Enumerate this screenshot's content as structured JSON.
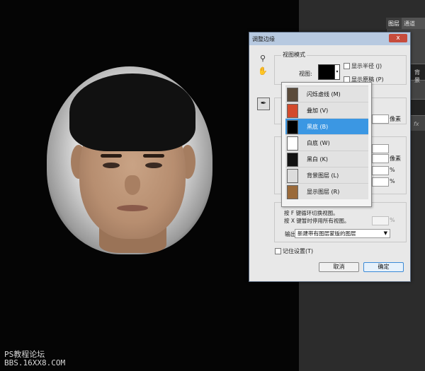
{
  "dialog": {
    "title": "调整边缘",
    "close_label": "x",
    "view_mode": {
      "group_title": "视图模式",
      "view_label": "视图:",
      "show_radius_label": "显示半径 (J)",
      "show_original_label": "显示原稿 (P)"
    },
    "view_menu": {
      "items": [
        {
          "label": "闪烁虚线 (M)",
          "icon_color": "#5a4a3a"
        },
        {
          "label": "叠加 (V)",
          "icon_color": "#d24a2c"
        },
        {
          "label": "黑底 (B)",
          "icon_color": "#000000"
        },
        {
          "label": "白底 (W)",
          "icon_color": "#ffffff"
        },
        {
          "label": "黑白 (K)",
          "icon_color": "#111111"
        },
        {
          "label": "背景图层 (L)",
          "icon_color": "#dcdcdc"
        },
        {
          "label": "显示图层 (R)",
          "icon_color": "#9a6a3a"
        }
      ],
      "selected_index": 2,
      "hint_1": "按 F 键循环切换视图。",
      "hint_2": "按 X 键暂时停用所有视图。"
    },
    "units": {
      "pixel_1": "像素",
      "pixel_2": "像素",
      "percent_1": "%",
      "percent_2": "%",
      "percent_3": "%"
    },
    "output": {
      "label": "输出到(O):",
      "value": "新建带有图层蒙版的图层"
    },
    "remember_label": "记住设置(T)",
    "cancel_label": "取消",
    "ok_label": "确定"
  },
  "panel": {
    "tabs": [
      "图层",
      "通道"
    ],
    "layer_label": "背景",
    "fx_label": "fx"
  },
  "watermark": {
    "line1": "PS教程论坛",
    "line2": "BBS.16XX8.COM"
  },
  "icons": {
    "zoom": "magnifier-icon",
    "hand": "hand-icon",
    "brush": "refine-brush-icon"
  }
}
